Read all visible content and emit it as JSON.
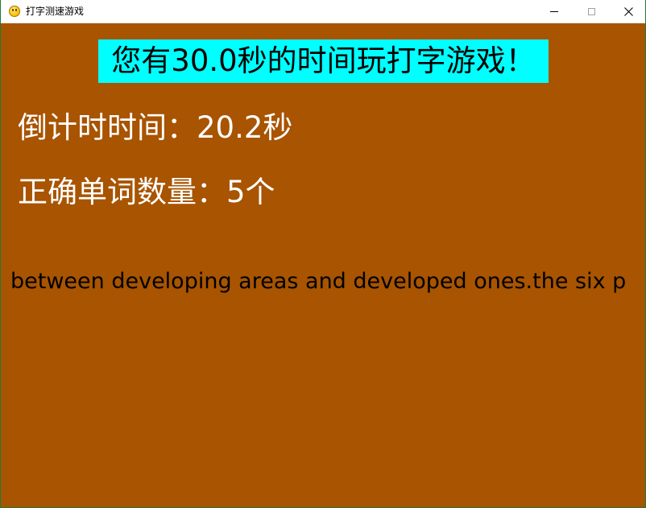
{
  "window": {
    "title": "打字测速游戏",
    "icon": "smiley-face-icon",
    "controls": {
      "minimize": "minimize-icon",
      "maximize": "maximize-icon",
      "close": "close-icon"
    }
  },
  "game": {
    "banner_text": "您有30.0秒的时间玩打字游戏！",
    "countdown_text": "倒计时时间：20.2秒",
    "correct_words_text": "正确单词数量：5个",
    "scrolling_text": "between developing areas and developed ones.the six p"
  },
  "colors": {
    "background": "#a85400",
    "banner_background": "#00ffff",
    "banner_text": "#000000",
    "info_text": "#ffffff",
    "scrolling_text": "#000000"
  }
}
